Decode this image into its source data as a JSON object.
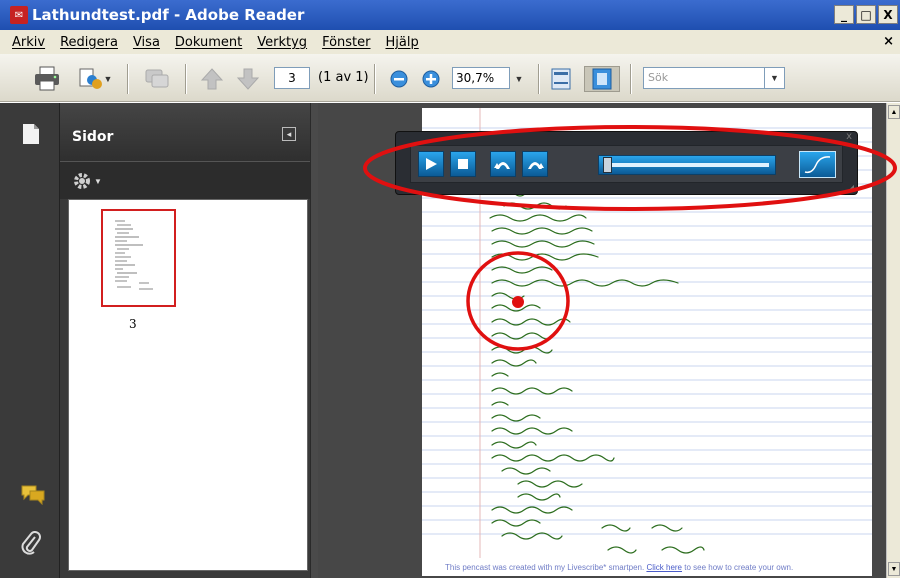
{
  "window": {
    "title": "Lathundtest.pdf - Adobe Reader",
    "app_icon": "pdf-icon",
    "controls": [
      "_",
      "□",
      "X"
    ]
  },
  "menu": {
    "items": [
      "Arkiv",
      "Redigera",
      "Visa",
      "Dokument",
      "Verktyg",
      "Fönster",
      "Hjälp"
    ],
    "close_glyph": "×"
  },
  "toolbar": {
    "page_number": "3",
    "page_of": "(1 av 1)",
    "zoom": "30,7%",
    "search_placeholder": "Sök",
    "icons": [
      "printer-icon",
      "collaborate-icon",
      "comment-icon",
      "prev-page-icon",
      "next-page-icon",
      "zoom-out-icon",
      "zoom-in-icon",
      "fit-width-icon",
      "fit-window-icon"
    ]
  },
  "sidebar": {
    "panel_title": "Sidor",
    "options_icon": "gear-icon",
    "thumbnail_label": "3",
    "rail_icons": [
      "pages-icon",
      "comments-icon",
      "attachments-icon"
    ]
  },
  "player": {
    "controls": [
      "play-icon",
      "stop-icon",
      "step-back-icon",
      "step-forward-icon",
      "graph-icon"
    ],
    "progress": 0.02,
    "close_glyph": "x"
  },
  "document": {
    "handwriting_color": "#2d6e1f",
    "footer_text": "This pencast was created with my Livescribe* smartpen.",
    "footer_link": "Click here",
    "footer_tail": "to see how to create your own."
  },
  "colors": {
    "annotation_red": "#e01010",
    "player_blue": "#1e86d0",
    "panel_dark": "#3a3a3a"
  }
}
